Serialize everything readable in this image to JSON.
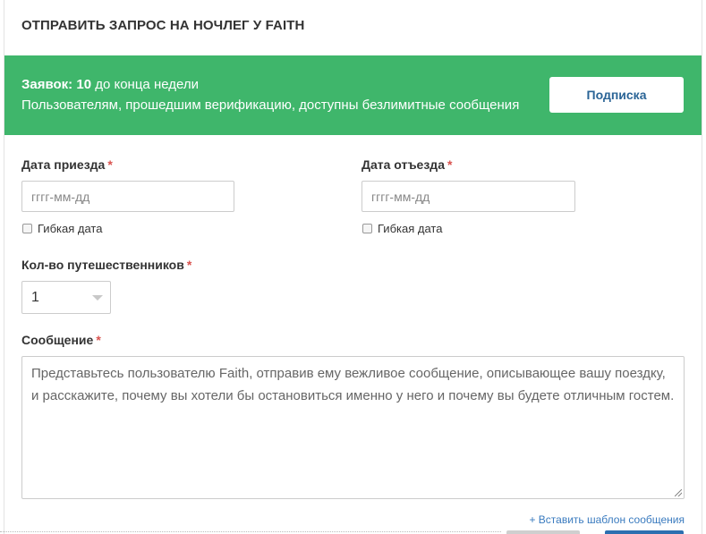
{
  "header": {
    "title": "ОТПРАВИТЬ ЗАПРОС НА НОЧЛЕГ У FAITH"
  },
  "banner": {
    "requests_label": "Заявок:",
    "requests_count": "10",
    "requests_suffix": "до конца недели",
    "info": "Пользователям, прошедшим верификацию, доступны безлимитные сообщения",
    "subscribe_label": "Подписка",
    "bg_color": "#3fb66b"
  },
  "form": {
    "required_mark": "*",
    "arrival": {
      "label": "Дата приезда",
      "placeholder": "гггг-мм-дд",
      "flexible_label": "Гибкая дата",
      "flexible_checked": false
    },
    "departure": {
      "label": "Дата отъезда",
      "placeholder": "гггг-мм-дд",
      "flexible_label": "Гибкая дата",
      "flexible_checked": false
    },
    "travelers": {
      "label": "Кол-во путешественников",
      "selected": "1"
    },
    "message": {
      "label": "Сообщение",
      "placeholder": "Представьтесь пользователю Faith, отправив ему вежливое сообщение, описывающее вашу поездку, и расскажите, почему вы хотели бы остановиться именно у него и почему вы будете отличным гостем."
    },
    "template_link": "+ Вставить шаблон сообщения"
  },
  "icons": {
    "select_caret": "chevron-down-icon",
    "resize": "resize-grip-icon",
    "checkbox": "checkbox-icon"
  }
}
